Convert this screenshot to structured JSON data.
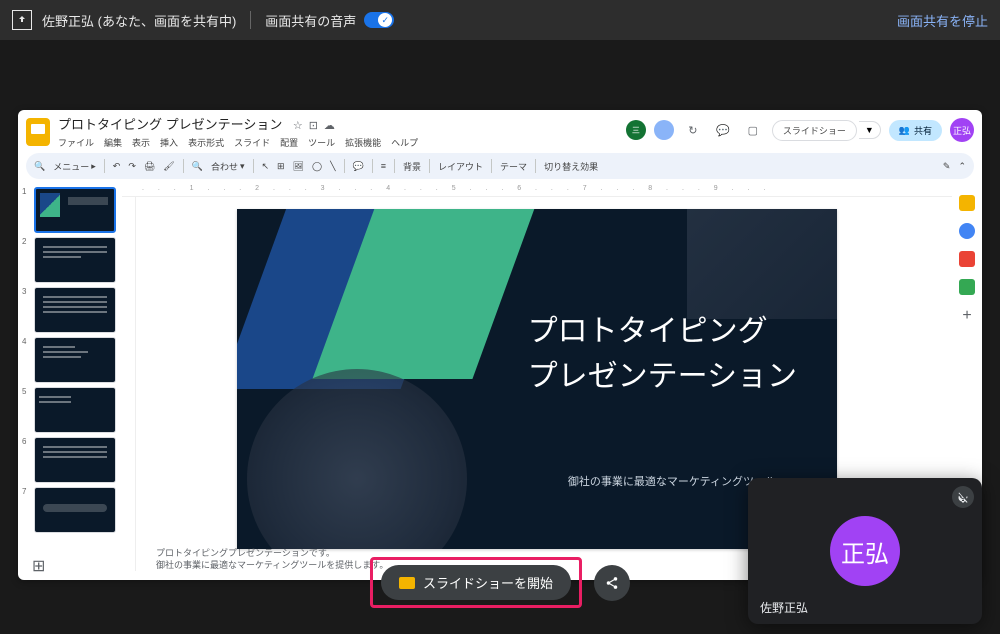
{
  "share_bar": {
    "user_status": "佐野正弘 (あなた、画面を共有中)",
    "audio_label": "画面共有の音声",
    "stop_label": "画面共有を停止"
  },
  "app": {
    "title": "プロトタイピング プレゼンテーション",
    "menus": [
      "ファイル",
      "編集",
      "表示",
      "挿入",
      "表示形式",
      "スライド",
      "配置",
      "ツール",
      "拡張機能",
      "ヘルプ"
    ],
    "slideshow_label": "スライドショー",
    "share_label": "共有",
    "profile_initials": "正弘"
  },
  "toolbar": {
    "menu_label": "メニュー",
    "fit_label": "合わせ",
    "bg_label": "背景",
    "layout_label": "レイアウト",
    "theme_label": "テーマ",
    "transition_label": "切り替え効果"
  },
  "thumbnails": [
    {
      "num": "1"
    },
    {
      "num": "2"
    },
    {
      "num": "3"
    },
    {
      "num": "4"
    },
    {
      "num": "5"
    },
    {
      "num": "6"
    },
    {
      "num": "7"
    }
  ],
  "slide": {
    "title_line1": "プロトタイピング",
    "title_line2": "プレゼンテーション",
    "subtitle": "御社の事業に最適なマーケティングツール。"
  },
  "bottom": {
    "start_slideshow": "スライドショーを開始"
  },
  "speaker_notes": {
    "line1": "プロトタイピングプレゼンテーションです。",
    "line2": "御社の事業に最適なマーケティングツールを提供します。"
  },
  "video": {
    "avatar_text": "正弘",
    "name": "佐野正弘"
  }
}
